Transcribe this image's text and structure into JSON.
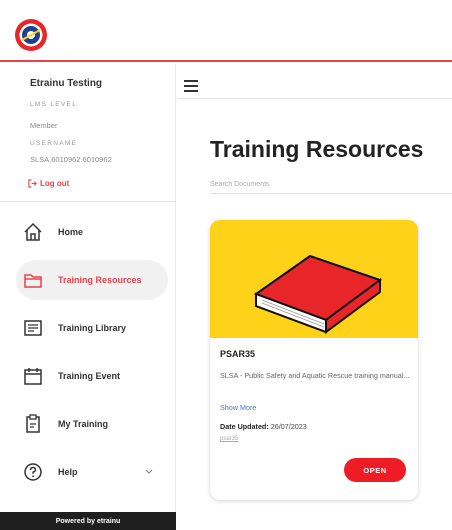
{
  "user": {
    "name": "Etrainu Testing",
    "lms_level_label": "LMS LEVEL",
    "lms_level_value": "Member",
    "username_label": "USERNAME",
    "username_value": "SLSA.6010962.6010962",
    "logout_label": "Log out"
  },
  "nav": {
    "items": [
      {
        "label": "Home",
        "icon": "home-icon"
      },
      {
        "label": "Training Resources",
        "icon": "folder-icon",
        "active": true
      },
      {
        "label": "Training Library",
        "icon": "library-icon"
      },
      {
        "label": "Training Event",
        "icon": "calendar-icon"
      },
      {
        "label": "My Training",
        "icon": "clipboard-icon"
      },
      {
        "label": "Help",
        "icon": "help-icon"
      }
    ]
  },
  "footer": {
    "powered": "Powered by etrainu"
  },
  "page": {
    "title": "Training Resources",
    "search_placeholder": "Search Documents"
  },
  "resource": {
    "title": "PSAR35",
    "description": "SLSA - Public Safety and Aquatic Rescue training manual...",
    "show_more": "Show More",
    "updated_label": "Date Updated:",
    "updated_value": "26/07/2023",
    "slug": "psar35",
    "open_label": "OPEN"
  },
  "colors": {
    "accent": "#e8434a",
    "card_bg": "#ffd21a",
    "book": "#e8262a",
    "button": "#ee1c25"
  }
}
